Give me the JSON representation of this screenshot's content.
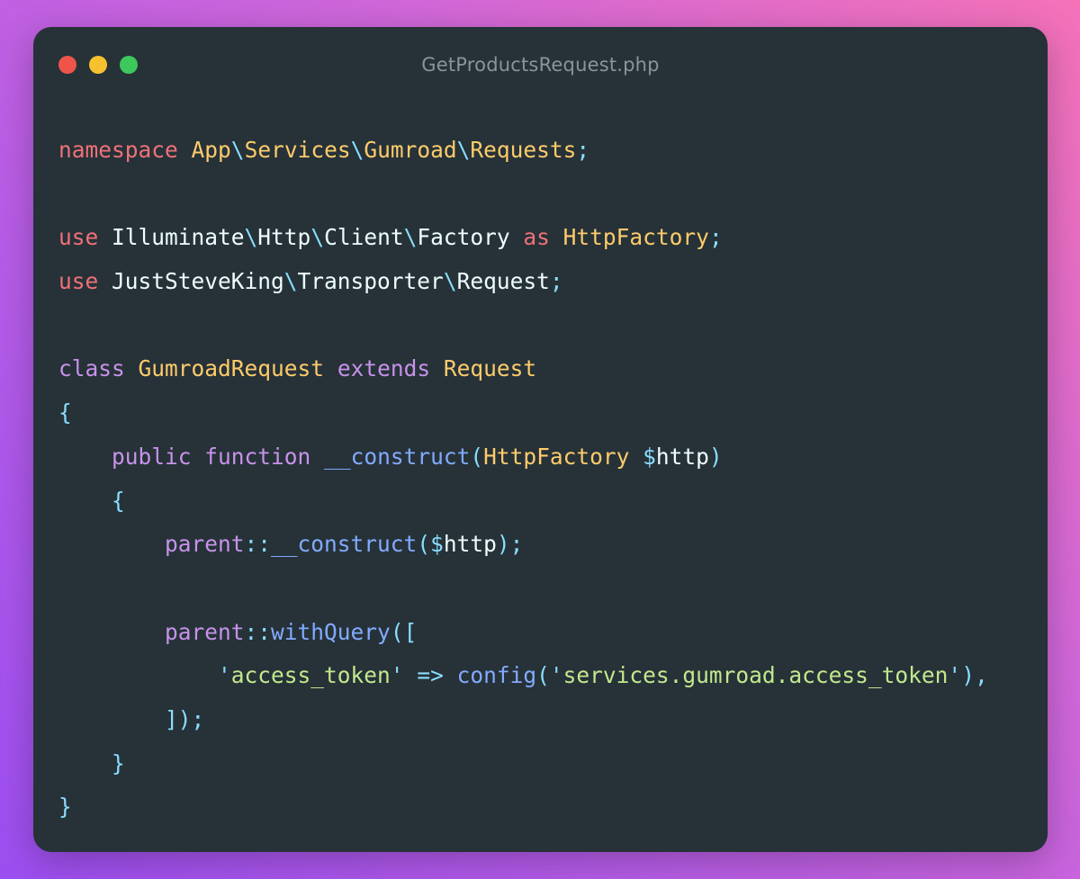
{
  "window": {
    "filename": "GetProductsRequest.php",
    "controls": [
      {
        "name": "close",
        "color": "#ee5449"
      },
      {
        "name": "minimize",
        "color": "#f7c02e"
      },
      {
        "name": "maximize",
        "color": "#3cc85a"
      }
    ]
  },
  "colors": {
    "keyword_red": "#f07178",
    "keyword_purple": "#c792ea",
    "class_yellow": "#ffcb6b",
    "punct_cyan": "#89ddff",
    "func_blue": "#82aaff",
    "string_green": "#c3e88d",
    "text_white": "#eeffff",
    "background": "#263238"
  },
  "code_lines": [
    [
      {
        "t": "namespace",
        "c": "kr"
      },
      {
        "t": " ",
        "c": "w"
      },
      {
        "t": "App",
        "c": "y"
      },
      {
        "t": "\\",
        "c": "p"
      },
      {
        "t": "Services",
        "c": "y"
      },
      {
        "t": "\\",
        "c": "p"
      },
      {
        "t": "Gumroad",
        "c": "y"
      },
      {
        "t": "\\",
        "c": "p"
      },
      {
        "t": "Requests",
        "c": "y"
      },
      {
        "t": ";",
        "c": "p"
      }
    ],
    [],
    [
      {
        "t": "use",
        "c": "kr"
      },
      {
        "t": " Illuminate",
        "c": "w"
      },
      {
        "t": "\\",
        "c": "p"
      },
      {
        "t": "Http",
        "c": "w"
      },
      {
        "t": "\\",
        "c": "p"
      },
      {
        "t": "Client",
        "c": "w"
      },
      {
        "t": "\\",
        "c": "p"
      },
      {
        "t": "Factory",
        "c": "w"
      },
      {
        "t": " ",
        "c": "w"
      },
      {
        "t": "as",
        "c": "kr"
      },
      {
        "t": " ",
        "c": "w"
      },
      {
        "t": "HttpFactory",
        "c": "y"
      },
      {
        "t": ";",
        "c": "p"
      }
    ],
    [
      {
        "t": "use",
        "c": "kr"
      },
      {
        "t": " JustSteveKing",
        "c": "w"
      },
      {
        "t": "\\",
        "c": "p"
      },
      {
        "t": "Transporter",
        "c": "w"
      },
      {
        "t": "\\",
        "c": "p"
      },
      {
        "t": "Request",
        "c": "w"
      },
      {
        "t": ";",
        "c": "p"
      }
    ],
    [],
    [
      {
        "t": "class",
        "c": "kp"
      },
      {
        "t": " ",
        "c": "w"
      },
      {
        "t": "GumroadRequest",
        "c": "y"
      },
      {
        "t": " ",
        "c": "w"
      },
      {
        "t": "extends",
        "c": "kp"
      },
      {
        "t": " ",
        "c": "w"
      },
      {
        "t": "Request",
        "c": "y"
      }
    ],
    [
      {
        "t": "{",
        "c": "p"
      }
    ],
    [
      {
        "t": "    ",
        "c": "w"
      },
      {
        "t": "public",
        "c": "kp"
      },
      {
        "t": " ",
        "c": "w"
      },
      {
        "t": "function",
        "c": "kp"
      },
      {
        "t": " ",
        "c": "w"
      },
      {
        "t": "__construct",
        "c": "b"
      },
      {
        "t": "(",
        "c": "p"
      },
      {
        "t": "HttpFactory",
        "c": "y"
      },
      {
        "t": " ",
        "c": "w"
      },
      {
        "t": "$",
        "c": "p"
      },
      {
        "t": "http",
        "c": "w"
      },
      {
        "t": ")",
        "c": "p"
      }
    ],
    [
      {
        "t": "    ",
        "c": "w"
      },
      {
        "t": "{",
        "c": "p"
      }
    ],
    [
      {
        "t": "        ",
        "c": "w"
      },
      {
        "t": "parent",
        "c": "kp"
      },
      {
        "t": "::",
        "c": "p"
      },
      {
        "t": "__construct",
        "c": "b"
      },
      {
        "t": "(",
        "c": "p"
      },
      {
        "t": "$",
        "c": "p"
      },
      {
        "t": "http",
        "c": "w"
      },
      {
        "t": ");",
        "c": "p"
      }
    ],
    [],
    [
      {
        "t": "        ",
        "c": "w"
      },
      {
        "t": "parent",
        "c": "kp"
      },
      {
        "t": "::",
        "c": "p"
      },
      {
        "t": "withQuery",
        "c": "b"
      },
      {
        "t": "([",
        "c": "p"
      }
    ],
    [
      {
        "t": "            ",
        "c": "w"
      },
      {
        "t": "'",
        "c": "p"
      },
      {
        "t": "access_token",
        "c": "g"
      },
      {
        "t": "'",
        "c": "p"
      },
      {
        "t": " ",
        "c": "w"
      },
      {
        "t": "=>",
        "c": "p"
      },
      {
        "t": " ",
        "c": "w"
      },
      {
        "t": "config",
        "c": "b"
      },
      {
        "t": "(",
        "c": "p"
      },
      {
        "t": "'",
        "c": "p"
      },
      {
        "t": "services.gumroad.access_token",
        "c": "g"
      },
      {
        "t": "'",
        "c": "p"
      },
      {
        "t": "),",
        "c": "p"
      }
    ],
    [
      {
        "t": "        ",
        "c": "w"
      },
      {
        "t": "]);",
        "c": "p"
      }
    ],
    [
      {
        "t": "    ",
        "c": "w"
      },
      {
        "t": "}",
        "c": "p"
      }
    ],
    [
      {
        "t": "}",
        "c": "p"
      }
    ]
  ]
}
